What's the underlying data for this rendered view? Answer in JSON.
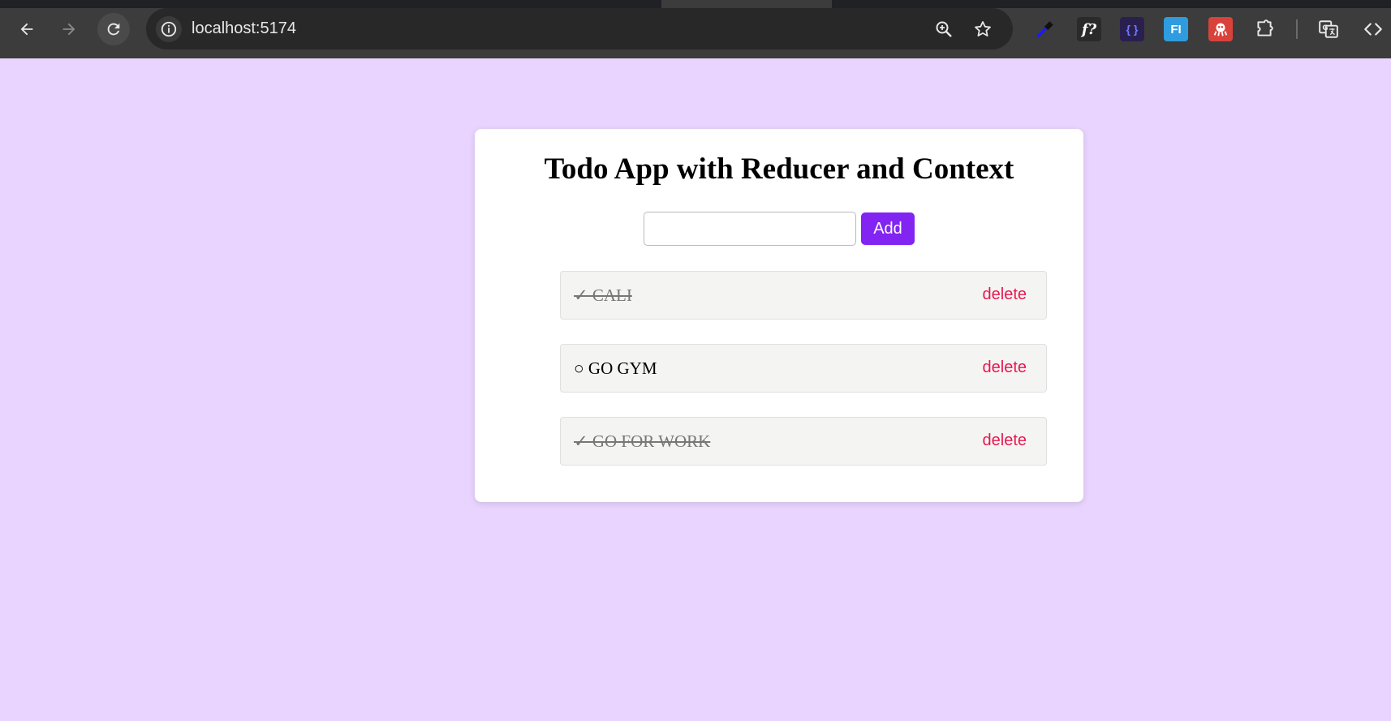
{
  "browser": {
    "url": "localhost:5174",
    "icons": {
      "back": "arrow-left-icon",
      "forward": "arrow-right-icon",
      "reload": "reload-icon",
      "site_info": "info-icon",
      "zoom": "zoom-in-icon",
      "bookmark": "star-icon",
      "extensions": [
        "eyedropper-icon",
        "font-ninja-icon",
        "json-formatter-icon",
        "fi-extension-icon",
        "octopus-extension-icon",
        "puzzle-icon",
        "translate-icon",
        "code-icon"
      ]
    },
    "ext_labels": {
      "font": "f?",
      "json": "{ }",
      "fi": "FI"
    }
  },
  "app": {
    "title": "Todo App with Reducer and Context",
    "input_value": "",
    "add_label": "Add",
    "todos": [
      {
        "text": "✓ CALI",
        "done": true,
        "delete_label": "delete"
      },
      {
        "text": "○ GO GYM",
        "done": false,
        "delete_label": "delete"
      },
      {
        "text": "✓ GO FOR WORK",
        "done": true,
        "delete_label": "delete"
      }
    ]
  },
  "colors": {
    "page_background": "#e8d4fe",
    "card_background": "#ffffff",
    "add_button": "#8224f2",
    "delete_text": "#e8174f",
    "todo_background": "#f4f4f3",
    "chrome_background": "#3c3c3c",
    "omnibox_background": "#282828"
  }
}
